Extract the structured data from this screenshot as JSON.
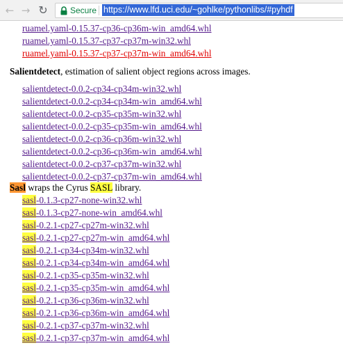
{
  "browser": {
    "secure_label": "Secure",
    "url": "https://www.lfd.uci.edu/~gohlke/pythonlibs/#pyhdf"
  },
  "ruamel_links": [
    "ruamel.yaml-0.15.37-cp36-cp36m-win_amd64.whl",
    "ruamel.yaml-0.15.37-cp37-cp37m-win32.whl",
    "ruamel.yaml-0.15.37-cp37-cp37m-win_amd64.whl"
  ],
  "salientdetect": {
    "name": "Salientdetect",
    "description": ", estimation of salient object regions across images.",
    "links": [
      "salientdetect-0.0.2-cp34-cp34m-win32.whl",
      "salientdetect-0.0.2-cp34-cp34m-win_amd64.whl",
      "salientdetect-0.0.2-cp35-cp35m-win32.whl",
      "salientdetect-0.0.2-cp35-cp35m-win_amd64.whl",
      "salientdetect-0.0.2-cp36-cp36m-win32.whl",
      "salientdetect-0.0.2-cp36-cp36m-win_amd64.whl",
      "salientdetect-0.0.2-cp37-cp37m-win32.whl",
      "salientdetect-0.0.2-cp37-cp37m-win_amd64.whl"
    ]
  },
  "sasl": {
    "name": "Sasl",
    "desc_before": " wraps the Cyrus ",
    "desc_highlight": "SASL",
    "desc_after": " library.",
    "link_prefix": "sasl",
    "link_suffixes": [
      "-0.1.3-cp27-none-win32.whl",
      "-0.1.3-cp27-none-win_amd64.whl",
      "-0.2.1-cp27-cp27m-win32.whl",
      "-0.2.1-cp27-cp27m-win_amd64.whl",
      "-0.2.1-cp34-cp34m-win32.whl",
      "-0.2.1-cp34-cp34m-win_amd64.whl",
      "-0.2.1-cp35-cp35m-win32.whl",
      "-0.2.1-cp35-cp35m-win_amd64.whl",
      "-0.2.1-cp36-cp36m-win32.whl",
      "-0.2.1-cp36-cp36m-win_amd64.whl",
      "-0.2.1-cp37-cp37m-win32.whl",
      "-0.2.1-cp37-cp37m-win_amd64.whl"
    ]
  },
  "colors": {
    "link": "#1a0dab",
    "visited": "#551a8b",
    "active": "#e00000",
    "find_highlight": "#ffff40",
    "find_current": "#ff9632",
    "url_selection": "#3367d6"
  }
}
